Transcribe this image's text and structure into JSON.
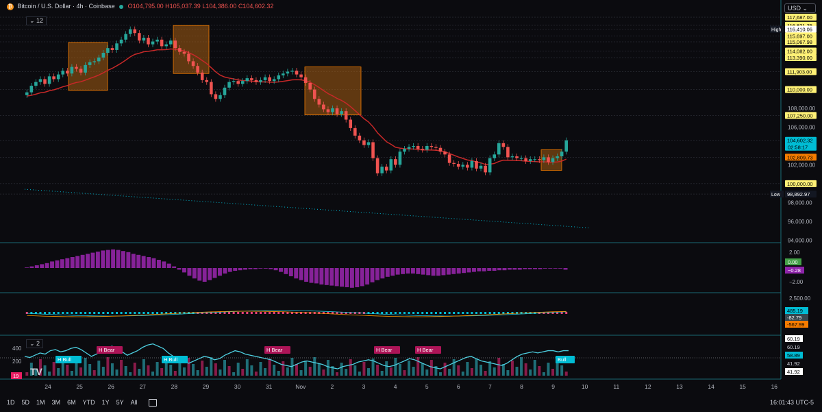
{
  "header": {
    "symbol": "Bitcoin / U.S. Dollar · 4h · Coinbase",
    "open": "O104,795.00",
    "high": "H105,037.39",
    "low": "L104,386.00",
    "close": "C104,602.32"
  },
  "indicator_count": "12",
  "indicator_count2": "2",
  "currency_button": "USD",
  "time_ranges": [
    "1D",
    "5D",
    "1M",
    "3M",
    "6M",
    "YTD",
    "1Y",
    "5Y",
    "All"
  ],
  "clock": "16:01:43 UTC-5",
  "tv_logo_text": "TV",
  "colors": {
    "up": "#26a69a",
    "down": "#ef5350",
    "accent": "#7b1fa2",
    "cyan": "#00bcd4",
    "orange": "#f57c00",
    "yellow": "#ffeb3b",
    "bg": "#0b0b0f"
  },
  "chart_data": [
    {
      "type": "candlestick",
      "panel": "price",
      "y_ticks": [
        "108,000.00",
        "106,000.00",
        "102,000.00",
        "98,000.00",
        "96,000.00",
        "94,000.00"
      ],
      "y_ticks_values": [
        108000,
        106000,
        102000,
        98000,
        96000,
        94000
      ],
      "ylim": [
        93800,
        118200
      ],
      "price_labels": [
        {
          "text": "117,687.00",
          "value": 117687,
          "style": "yellow"
        },
        {
          "text": "116,821.25",
          "value": 116821,
          "style": "yellow"
        },
        {
          "text": "116,410.06",
          "value": 116410,
          "style": "white",
          "tag": "High"
        },
        {
          "text": "115,697.00",
          "value": 115697,
          "style": "yellow"
        },
        {
          "text": "115,067.98",
          "value": 115068,
          "style": "yellow"
        },
        {
          "text": "114,082.00",
          "value": 114082,
          "style": "yellow"
        },
        {
          "text": "113,390.00",
          "value": 113390,
          "style": "yellow"
        },
        {
          "text": "111,903.00",
          "value": 111903,
          "style": "yellow"
        },
        {
          "text": "110,000.00",
          "value": 110000,
          "style": "yellow"
        },
        {
          "text": "107,250.00",
          "value": 107250,
          "style": "yellow"
        },
        {
          "text": "104,602.32",
          "value": 104602,
          "style": "cyan",
          "sub": "02:58:17"
        },
        {
          "text": "102,809.73",
          "value": 102810,
          "style": "orange"
        },
        {
          "text": "100,000.00",
          "value": 100000,
          "style": "yellow"
        },
        {
          "text": "98,892.97",
          "value": 98893,
          "style": "navy",
          "tag": "Low"
        }
      ],
      "x_labels": [
        "24",
        "25",
        "26",
        "27",
        "28",
        "29",
        "30",
        "31",
        "Nov",
        "2",
        "3",
        "4",
        "5",
        "6",
        "7",
        "8",
        "9",
        "10",
        "11",
        "12",
        "13",
        "14",
        "15",
        "16"
      ],
      "closes": [
        109700,
        110400,
        110800,
        111100,
        110600,
        111400,
        111100,
        111600,
        112000,
        111700,
        112400,
        112200,
        111800,
        112600,
        112900,
        113000,
        113400,
        113900,
        114400,
        114200,
        114900,
        115300,
        115900,
        116400,
        116000,
        115200,
        115500,
        114800,
        115100,
        115300,
        114600,
        114800,
        115200,
        114400,
        114000,
        113800,
        113000,
        112500,
        111800,
        111000,
        110800,
        109500,
        109000,
        109400,
        110200,
        110800,
        110900,
        110600,
        110900,
        111200,
        111000,
        110800,
        111000,
        111300,
        110900,
        111100,
        111500,
        111700,
        111900,
        112000,
        111600,
        111300,
        110700,
        110000,
        109000,
        108400,
        107900,
        107600,
        108000,
        107400,
        107700,
        106800,
        105900,
        105100,
        104600,
        104100,
        104400,
        102700,
        101100,
        101800,
        101400,
        102600,
        102000,
        103400,
        103700,
        103900,
        104000,
        103700,
        103600,
        104000,
        103900,
        103800,
        103400,
        103100,
        102200,
        102100,
        101800,
        102000,
        101700,
        102400,
        101600,
        101900,
        101200,
        102700,
        103100,
        104300,
        103900,
        102800,
        102900,
        102700,
        102700,
        102400,
        102600,
        102600,
        102500,
        102800,
        102300,
        102700,
        102900,
        103400,
        104600
      ]
    },
    {
      "type": "histogram",
      "panel": "oscillator",
      "y_ticks": [
        "2.00",
        "−2.00"
      ],
      "labels": [
        {
          "text": "0.00",
          "style": "green"
        },
        {
          "text": "−0.28",
          "style": "purple"
        }
      ],
      "values": [
        0.1,
        0.3,
        0.5,
        0.7,
        0.9,
        1.2,
        1.4,
        1.6,
        1.8,
        2.0,
        2.2,
        2.4,
        2.6,
        2.8,
        3.0,
        3.2,
        3.3,
        3.4,
        3.3,
        3.1,
        2.9,
        2.6,
        2.4,
        2.2,
        2.0,
        1.8,
        1.5,
        1.2,
        0.8,
        0.3,
        -0.3,
        -0.8,
        -1.4,
        -1.9,
        -2.3,
        -2.5,
        -2.2,
        -1.8,
        -1.4,
        -1.0,
        -0.7,
        -0.5,
        -0.4,
        -0.3,
        -0.2,
        -0.2,
        -0.1,
        -0.1,
        -0.2,
        -0.4,
        -0.7,
        -1.1,
        -1.5,
        -1.9,
        -2.2,
        -2.5,
        -2.7,
        -2.8,
        -3.0,
        -3.1,
        -3.2,
        -3.3,
        -3.4,
        -3.5,
        -3.6,
        -3.5,
        -3.3,
        -3.0,
        -2.6,
        -2.2,
        -1.9,
        -1.6,
        -1.4,
        -1.2,
        -1.1,
        -1.0,
        -1.0,
        -1.1,
        -1.2,
        -1.3,
        -1.4,
        -1.4,
        -1.3,
        -1.2,
        -1.1,
        -1.0,
        -0.9,
        -0.8,
        -0.7,
        -0.6,
        -0.6,
        -0.5,
        -0.5,
        -0.4,
        -0.4,
        -0.3,
        -0.3,
        -0.3,
        -0.2,
        -0.2,
        -0.2,
        -0.2,
        -0.1,
        -0.1,
        -0.1,
        -0.1,
        -0.3
      ]
    },
    {
      "type": "line",
      "panel": "macd",
      "y_ticks": [
        "2,500.00"
      ],
      "labels": [
        {
          "text": "485.19",
          "style": "cyan"
        },
        {
          "text": "-82.79",
          "style": "gray"
        },
        {
          "text": "-567.99",
          "style": "orange"
        }
      ]
    },
    {
      "type": "line",
      "panel": "rsi",
      "y_ticks": [
        "400",
        "200"
      ],
      "labels": [
        {
          "text": "60.19",
          "style": "white"
        },
        {
          "text": "60.19",
          "style": "plain"
        },
        {
          "text": "58.89",
          "style": "cyan"
        },
        {
          "text": "41.92",
          "style": "plain"
        },
        {
          "text": "41.92",
          "style": "white"
        }
      ],
      "corner_value": "19",
      "tags": [
        {
          "text": "H Bull",
          "style": "cyan",
          "xi": 45
        },
        {
          "text": "H Bear",
          "style": "magenta",
          "xi": 105
        },
        {
          "text": "H Bull",
          "style": "cyan",
          "xi": 200
        },
        {
          "text": "H Bear",
          "style": "magenta",
          "xi": 350
        },
        {
          "text": "H Bear",
          "style": "magenta",
          "xi": 510
        },
        {
          "text": "H Bear",
          "style": "magenta",
          "xi": 570
        },
        {
          "text": "Bull",
          "style": "cyan",
          "xi": 775
        }
      ],
      "values": [
        55,
        54,
        56,
        58,
        57,
        60,
        61,
        59,
        60,
        62,
        63,
        61,
        58,
        55,
        57,
        60,
        62,
        64,
        62,
        59,
        56,
        58,
        60,
        63,
        65,
        66,
        64,
        62,
        58,
        55,
        52,
        50,
        49,
        51,
        53,
        55,
        54,
        52,
        53,
        56,
        58,
        60,
        59,
        57,
        56,
        55,
        54,
        53,
        52,
        50,
        48,
        47,
        46,
        48,
        50,
        51,
        50,
        49,
        48,
        46,
        45,
        44,
        46,
        47,
        48,
        50,
        51,
        52,
        51,
        49,
        47,
        46,
        47,
        49,
        51,
        53,
        52,
        50,
        48,
        46,
        45,
        44,
        46,
        48,
        50,
        52,
        54,
        55,
        53,
        51,
        50,
        49,
        48,
        47,
        49,
        52,
        55,
        57,
        58,
        59,
        58,
        59,
        60,
        60,
        59,
        60,
        60
      ]
    }
  ]
}
